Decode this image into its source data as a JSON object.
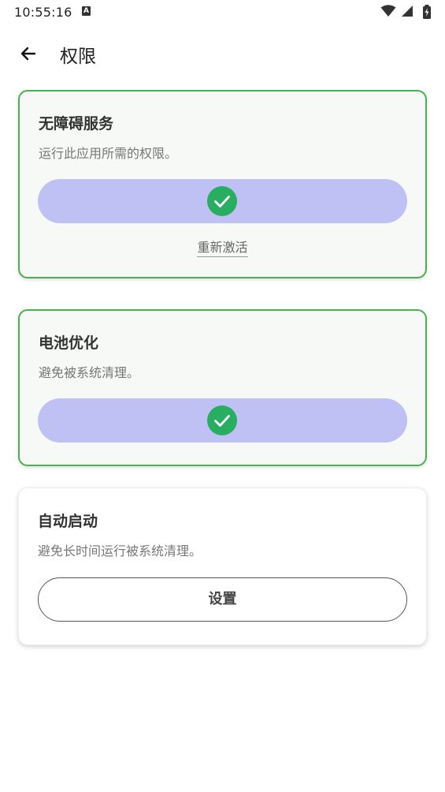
{
  "status_bar": {
    "time": "10:55:16",
    "notification_icon": "a-notification-icon",
    "wifi_icon": "wifi-icon",
    "signal_icon": "signal-icon",
    "battery_icon": "battery-charging-icon"
  },
  "app_bar": {
    "back_icon": "arrow-left-icon",
    "title": "权限"
  },
  "cards": {
    "accessibility": {
      "title": "无障碍服务",
      "description": "运行此应用所需的权限。",
      "status": "granted",
      "status_icon": "check-circle-icon",
      "reactivate_label": "重新激活"
    },
    "battery": {
      "title": "电池优化",
      "description": "避免被系统清理。",
      "status": "granted",
      "status_icon": "check-circle-icon"
    },
    "autostart": {
      "title": "自动启动",
      "description": "避免长时间运行被系统清理。",
      "button_label": "设置"
    }
  },
  "colors": {
    "granted_border": "#4caf50",
    "pill_background": "#bfc1f5",
    "check_green": "#27ae60"
  }
}
